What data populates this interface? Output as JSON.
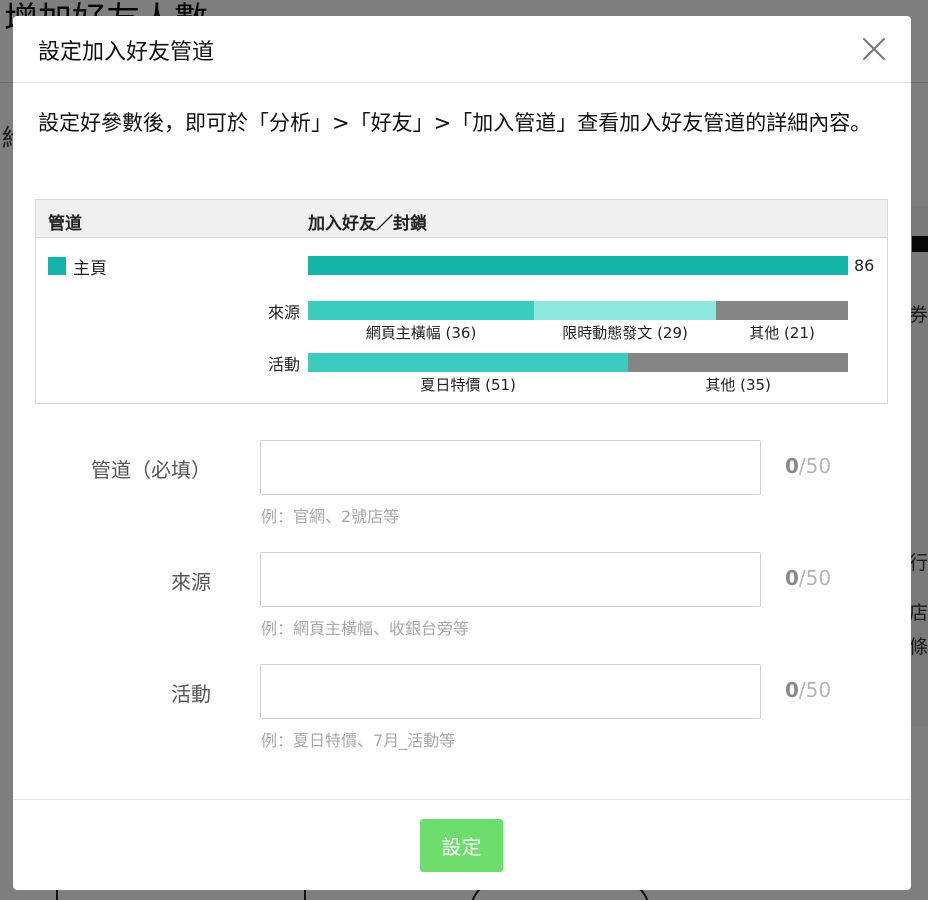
{
  "background": {
    "title": "增加好友人數",
    "left_char": "給",
    "side_texts": [
      "券",
      "行",
      "店",
      "條"
    ]
  },
  "modal": {
    "title": "設定加入好友管道",
    "description": "設定好參數後，即可於「分析」>「好友」>「加入管道」查看加入好友管道的詳細內容。"
  },
  "chart_data": {
    "type": "bar",
    "title": "",
    "columns": [
      "管道",
      "加入好友／封鎖"
    ],
    "legend": [
      {
        "name": "主頁",
        "color": "#14b4a8"
      }
    ],
    "total": {
      "name": "主頁",
      "value": 86,
      "label": "86",
      "color": "#14b4a8"
    },
    "rows": [
      {
        "label": "來源",
        "segments": [
          {
            "name": "網頁主橫幅",
            "value": 36,
            "label": "網頁主橫幅 (36)",
            "color": "#3cccbf"
          },
          {
            "name": "限時動態發文",
            "value": 29,
            "label": "限時動態發文 (29)",
            "color": "#8fe8e0"
          },
          {
            "name": "其他",
            "value": 21,
            "label": "其他 (21)",
            "color": "#858585"
          }
        ]
      },
      {
        "label": "活動",
        "segments": [
          {
            "name": "夏日特價",
            "value": 51,
            "label": "夏日特價 (51)",
            "color": "#3cccbf"
          },
          {
            "name": "其他",
            "value": 35,
            "label": "其他 (35)",
            "color": "#858585"
          }
        ]
      }
    ],
    "xlim": [
      0,
      86
    ]
  },
  "form": {
    "fields": [
      {
        "label": "管道（必填）",
        "value": "",
        "count": "0",
        "max": "/50",
        "hint": "例：官網、2號店等"
      },
      {
        "label": "來源",
        "value": "",
        "count": "0",
        "max": "/50",
        "hint": "例：網頁主橫幅、收銀台旁等"
      },
      {
        "label": "活動",
        "value": "",
        "count": "0",
        "max": "/50",
        "hint": "例：夏日特價、7月_活動等"
      }
    ]
  },
  "footer": {
    "submit_label": "設定"
  }
}
